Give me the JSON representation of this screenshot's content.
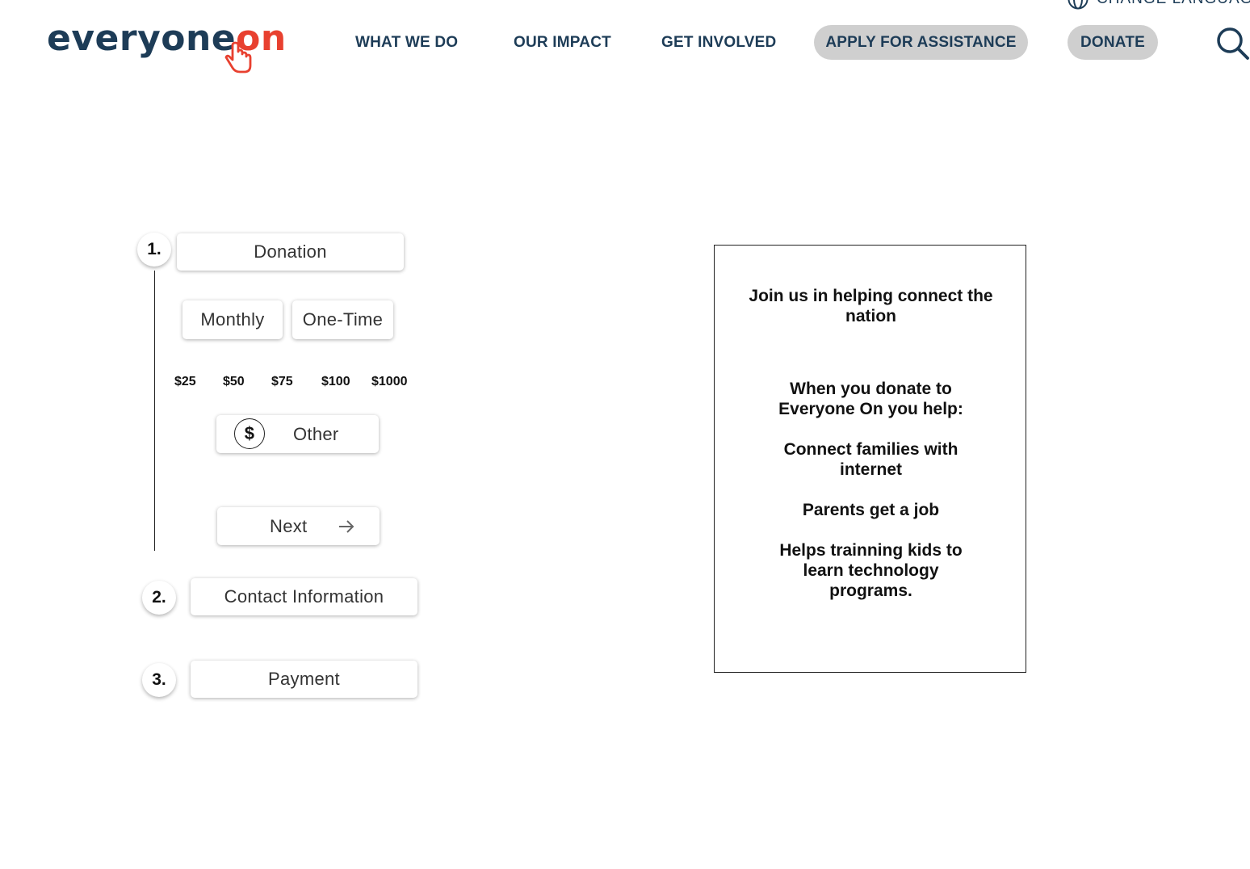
{
  "header": {
    "logo": {
      "main": "everyone",
      "accent": "on"
    },
    "language": "CHANGE LANGUAGE",
    "nav": [
      "WHAT WE DO",
      "OUR IMPACT",
      "GET INVOLVED"
    ],
    "apply_label": "APPLY FOR ASSISTANCE",
    "donate_label": "DONATE"
  },
  "form": {
    "step1": {
      "number": "1.",
      "label": "Donation"
    },
    "frequency": {
      "monthly": "Monthly",
      "one_time": "One-Time"
    },
    "amounts": [
      "$25",
      "$50",
      "$75",
      "$100",
      "$1000"
    ],
    "other": {
      "symbol": "$",
      "label": "Other"
    },
    "next_label": "Next",
    "step2": {
      "number": "2.",
      "label": "Contact Information"
    },
    "step3": {
      "number": "3.",
      "label": "Payment"
    }
  },
  "info": {
    "heading": "Join us in helping connect the nation",
    "intro": "When you donate to Everyone On you help:",
    "items": [
      "Connect families with internet",
      "Parents get a job",
      "Helps trainning kids to learn technology programs."
    ]
  },
  "colors": {
    "brand_navy": "#1d3c57",
    "brand_red": "#e8402f",
    "pill_gray": "#cfcfcf"
  }
}
